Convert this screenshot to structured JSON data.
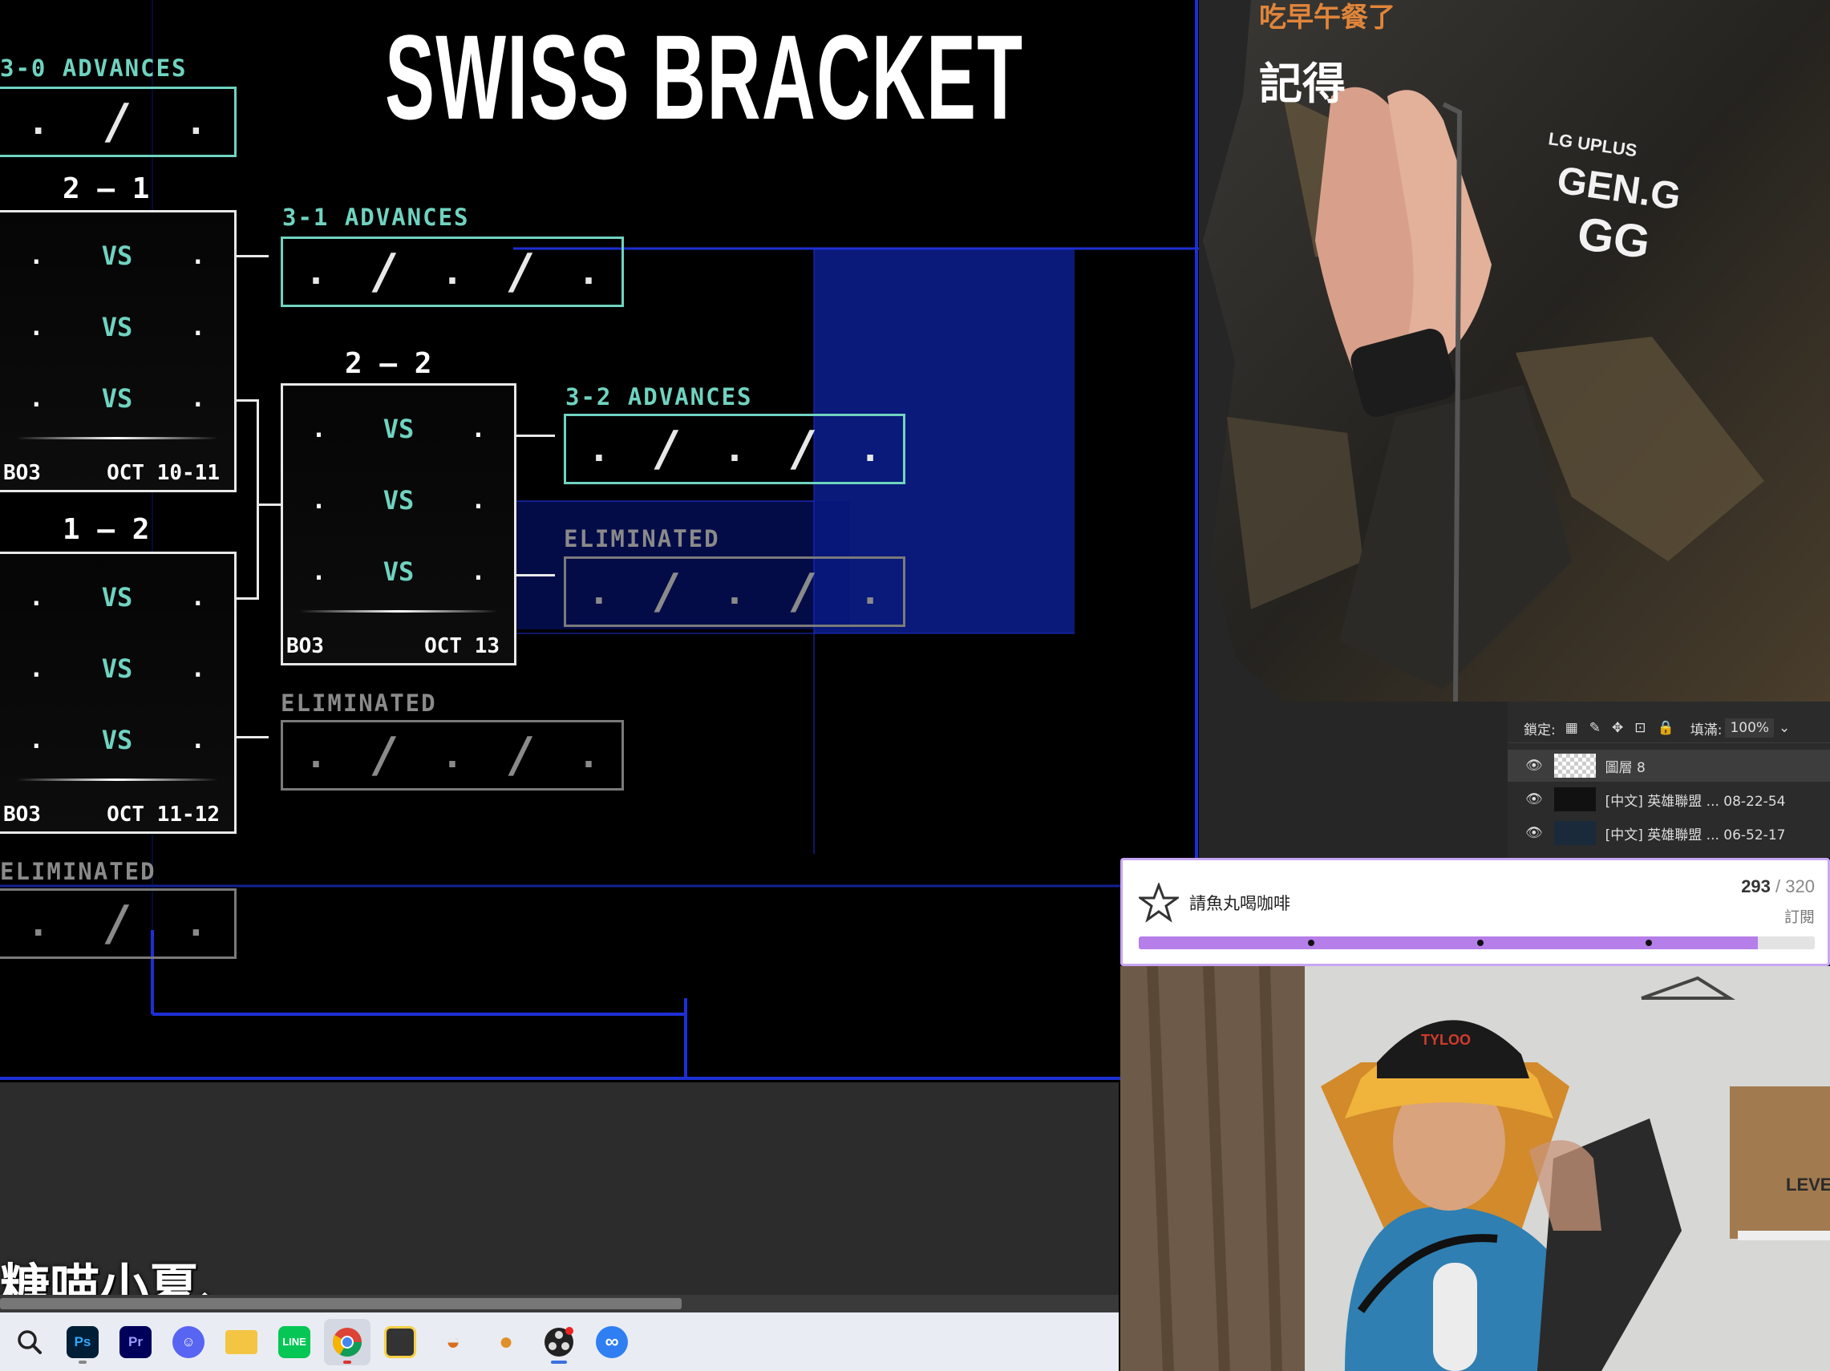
{
  "bracket": {
    "title": "SWISS BRACKET",
    "adv30": {
      "label": "3-0 ADVANCES",
      "slots": [
        ".",
        "/",
        "."
      ]
    },
    "r21": {
      "score": "2 – 1",
      "rows": [
        [
          ".",
          "VS",
          "."
        ],
        [
          ".",
          "VS",
          "."
        ],
        [
          ".",
          "VS",
          "."
        ]
      ],
      "format": "BO3",
      "date": "OCT 10-11"
    },
    "r12": {
      "score": "1 – 2",
      "rows": [
        [
          ".",
          "VS",
          "."
        ],
        [
          ".",
          "VS",
          "."
        ],
        [
          ".",
          "VS",
          "."
        ]
      ],
      "format": "BO3",
      "date": "OCT 11-12"
    },
    "elim03": {
      "label": "ELIMINATED",
      "slots": [
        ".",
        "/",
        "."
      ]
    },
    "adv31": {
      "label": "3-1 ADVANCES",
      "slots": [
        ".",
        "/",
        ".",
        "/",
        "."
      ]
    },
    "r22": {
      "score": "2 – 2",
      "rows": [
        [
          ".",
          "VS",
          "."
        ],
        [
          ".",
          "VS",
          "."
        ],
        [
          ".",
          "VS",
          "."
        ]
      ],
      "format": "BO3",
      "date": "OCT 13"
    },
    "elim13": {
      "label": "ELIMINATED",
      "slots": [
        ".",
        "/",
        ".",
        "/",
        "."
      ]
    },
    "adv32": {
      "label": "3-2 ADVANCES",
      "slots": [
        ".",
        "/",
        ".",
        "/",
        "."
      ]
    },
    "elim23": {
      "label": "ELIMINATED",
      "slots": [
        ".",
        "/",
        ".",
        "/",
        "."
      ]
    }
  },
  "subtitle": "糖喵小夏、",
  "chat": {
    "line1": "吃早午餐了",
    "line2": "記得"
  },
  "jacket": {
    "brand_top": "LG UPLUS",
    "brand": "GEN.G",
    "logo": "GG"
  },
  "layers_panel": {
    "lock_label": "鎖定:",
    "fill_label": "填滿:",
    "fill_value": "100%",
    "rows": [
      {
        "name": "圖層 8"
      },
      {
        "name": "[中文] 英雄聯盟 ... 08-22-54"
      },
      {
        "name": "[中文] 英雄聯盟 ... 06-52-17"
      }
    ]
  },
  "goal": {
    "title": "請魚丸喝咖啡",
    "current": "293",
    "target": "320",
    "separator": "/",
    "type": "訂閱",
    "progress": 0.916,
    "accent": "#b57ee8"
  },
  "webcam": {
    "cap_text": "TYLOO",
    "box_text": "LEVE"
  },
  "taskbar": {
    "icons": [
      {
        "name": "search-icon",
        "label": ""
      },
      {
        "name": "photoshop-icon",
        "label": "Ps"
      },
      {
        "name": "premiere-icon",
        "label": "Pr"
      },
      {
        "name": "discord-icon",
        "label": ""
      },
      {
        "name": "file-explorer-icon",
        "label": ""
      },
      {
        "name": "line-icon",
        "label": ""
      },
      {
        "name": "chrome-icon",
        "label": ""
      },
      {
        "name": "sticky-notes-icon",
        "label": ""
      },
      {
        "name": "hotdog-app-icon",
        "label": ""
      },
      {
        "name": "burger-app-icon",
        "label": ""
      },
      {
        "name": "obs-icon",
        "label": ""
      },
      {
        "name": "link-app-icon",
        "label": ""
      }
    ]
  },
  "colors": {
    "teal": "#6fd3c0",
    "blue_line": "#1d2fd4",
    "goal_bar": "#b57ee8"
  }
}
